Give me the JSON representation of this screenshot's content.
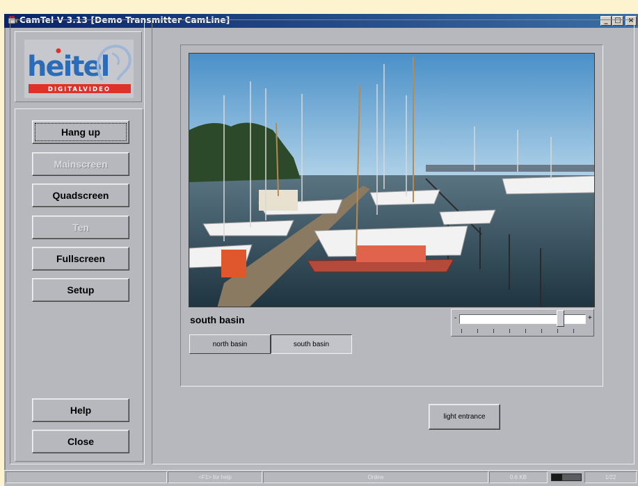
{
  "window": {
    "title": "CamTel   V 3.13 [Demo Transmitter CamLine]",
    "controls": {
      "minimize": "_",
      "maximize": "□",
      "close": "×"
    }
  },
  "logo": {
    "brand_text": "heitel",
    "sub_text": "DIGITALVIDEO",
    "colors": {
      "brand": "#2b6cb8",
      "sub_bg": "#e0302a",
      "sub_text": "#ffffff"
    }
  },
  "sidebar": {
    "buttons": [
      {
        "label": "Hang up",
        "enabled": true,
        "focused": true
      },
      {
        "label": "Mainscreen",
        "enabled": false
      },
      {
        "label": "Quadscreen",
        "enabled": true
      },
      {
        "label": "Ten",
        "enabled": false
      },
      {
        "label": "Fullscreen",
        "enabled": true
      },
      {
        "label": "Setup",
        "enabled": true
      }
    ],
    "bottom_buttons": [
      {
        "label": "Help"
      },
      {
        "label": "Close"
      }
    ]
  },
  "main": {
    "camera_name": "south basin",
    "slider": {
      "minus": "-",
      "plus": "+",
      "level": 0.8
    },
    "camera_buttons": [
      {
        "label": "north basin",
        "pressed": false
      },
      {
        "label": "south basin",
        "pressed": true
      }
    ],
    "action_button": "light entrance"
  },
  "statusbar": {
    "help_hint": "<F1> for help",
    "status": "Online",
    "size": "0.6 KB",
    "meter_level": 0.35,
    "counter": "1/22"
  }
}
